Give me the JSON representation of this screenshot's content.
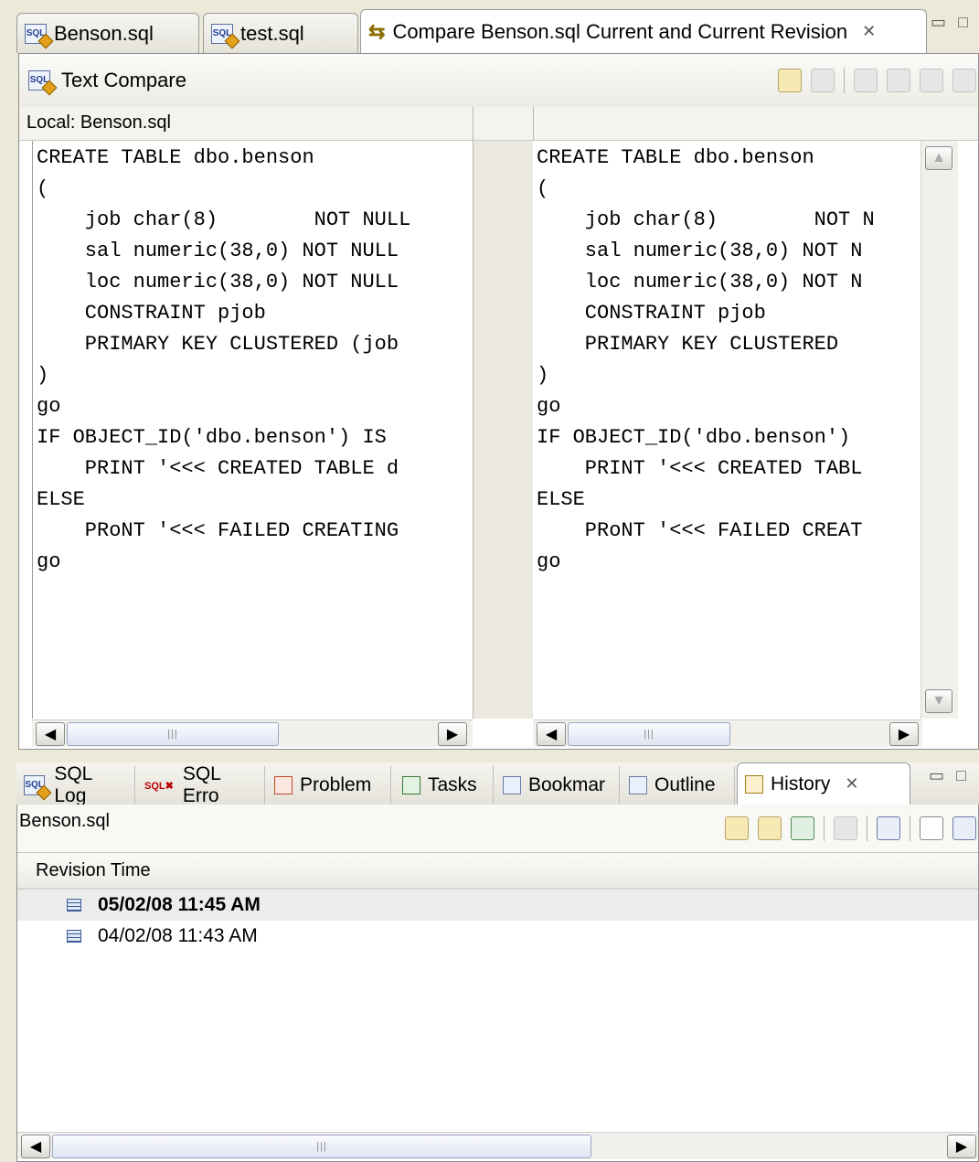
{
  "editor_tabs": [
    {
      "label": "Benson.sql"
    },
    {
      "label": "test.sql"
    },
    {
      "label": "Compare Benson.sql Current and Current Revision"
    }
  ],
  "compare": {
    "title": "Text Compare",
    "left_header": "Local: Benson.sql",
    "left_code": "CREATE TABLE dbo.benson\n(\n    job char(8)        NOT NULL\n    sal numeric(38,0) NOT NULL\n    loc numeric(38,0) NOT NULL\n    CONSTRAINT pjob\n    PRIMARY KEY CLUSTERED (job\n)\ngo\nIF OBJECT_ID('dbo.benson') IS\n    PRINT '<<< CREATED TABLE d\nELSE\n    PRoNT '<<< FAILED CREATING\ngo",
    "right_code": "CREATE TABLE dbo.benson\n(\n    job char(8)        NOT N\n    sal numeric(38,0) NOT N\n    loc numeric(38,0) NOT N\n    CONSTRAINT pjob\n    PRIMARY KEY CLUSTERED\n)\ngo\nIF OBJECT_ID('dbo.benson')\n    PRINT '<<< CREATED TABL\nELSE\n    PRoNT '<<< FAILED CREAT\ngo"
  },
  "views": [
    {
      "label": "SQL Log"
    },
    {
      "label": "SQL Erro"
    },
    {
      "label": "Problem"
    },
    {
      "label": "Tasks"
    },
    {
      "label": "Bookmar"
    },
    {
      "label": "Outline"
    },
    {
      "label": "History"
    }
  ],
  "history": {
    "file": "Benson.sql",
    "column_header": "Revision Time",
    "rows": [
      {
        "time": "05/02/08 11:45 AM"
      },
      {
        "time": "04/02/08 11:43 AM"
      }
    ]
  }
}
